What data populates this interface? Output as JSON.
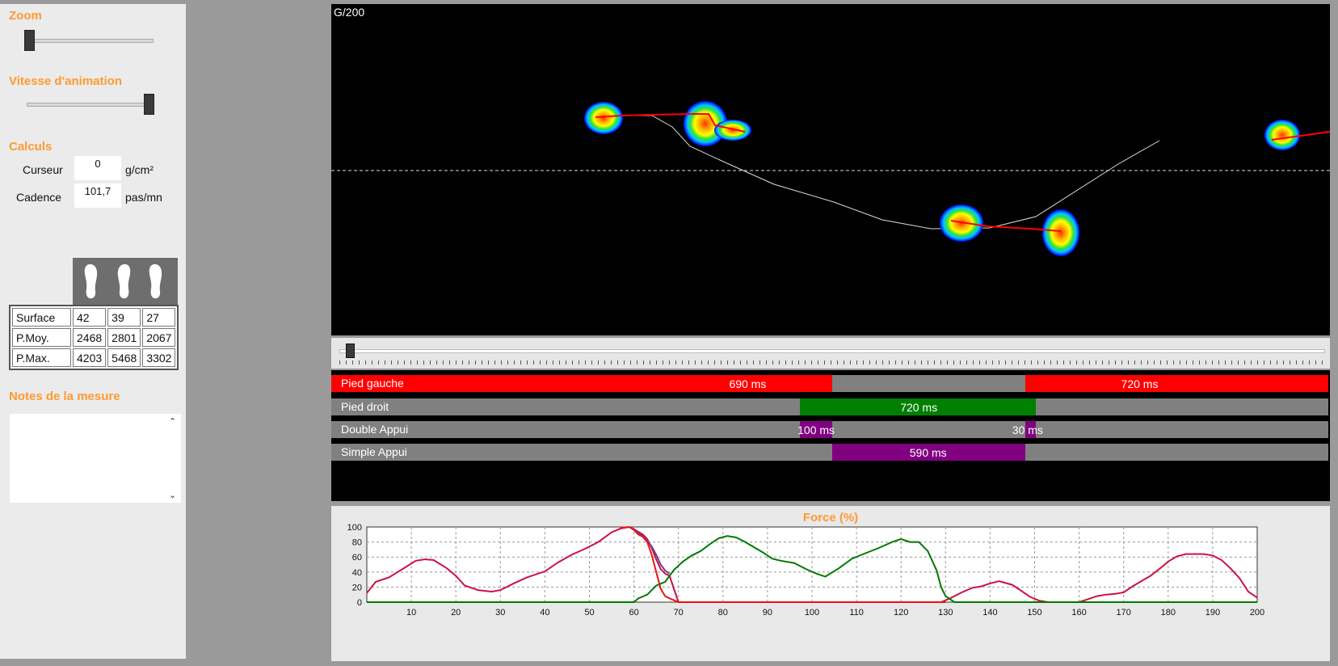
{
  "left": {
    "zoom_label": "Zoom",
    "zoom_value": 0.0,
    "speed_label": "Vitesse d'animation",
    "speed_value": 1.0,
    "calculs_label": "Calculs",
    "curseur_label": "Curseur",
    "curseur_value": "0",
    "curseur_unit": "g/cm²",
    "cadence_label": "Cadence",
    "cadence_value": "101,7",
    "cadence_unit": "pas/mn",
    "stats": [
      {
        "label": "Surface",
        "v1": "42",
        "v2": "39",
        "v3": "27"
      },
      {
        "label": "P.Moy.",
        "v1": "2468",
        "v2": "2801",
        "v3": "2067"
      },
      {
        "label": "P.Max.",
        "v1": "4203",
        "v2": "5468",
        "v3": "3302"
      }
    ],
    "notes_label": "Notes de la mesure"
  },
  "heatmap": {
    "label": "G/200"
  },
  "phases": [
    {
      "name": "Pied gauche",
      "segments": [
        {
          "start": 0,
          "end": 64.5,
          "color": "#ff0000",
          "label": "690 ms",
          "label_at": 37
        },
        {
          "start": 126.5,
          "end": 200,
          "color": "#ff0000",
          "label": "720 ms",
          "label_at": 163
        }
      ]
    },
    {
      "name": "Pied droit",
      "segments": [
        {
          "start": 54,
          "end": 130,
          "color": "#008000",
          "label": "720 ms",
          "label_at": 92
        }
      ]
    },
    {
      "name": "Double Appui",
      "segments": [
        {
          "start": 54,
          "end": 64.5,
          "color": "#800080",
          "label": "100 ms",
          "label_at": 59
        },
        {
          "start": 126.5,
          "end": 130,
          "color": "#800080",
          "label": "30 ms",
          "label_at": 128
        }
      ]
    },
    {
      "name": "Simple Appui",
      "segments": [
        {
          "start": 64.5,
          "end": 126.5,
          "color": "#800080",
          "label": "590 ms",
          "label_at": 95
        }
      ]
    }
  ],
  "force_title": "Force (%)",
  "chart_data": {
    "type": "line",
    "title": "Force (%)",
    "xlim": [
      0,
      200
    ],
    "ylim": [
      0,
      100
    ],
    "x_ticks": [
      10,
      20,
      30,
      40,
      50,
      60,
      70,
      80,
      90,
      100,
      110,
      120,
      130,
      140,
      150,
      160,
      170,
      180,
      190,
      200
    ],
    "y_ticks": [
      0,
      20,
      40,
      60,
      80,
      100
    ],
    "grid": true,
    "series": [
      {
        "color": "#cc1144",
        "points": [
          [
            0,
            12
          ],
          [
            2,
            27
          ],
          [
            5,
            33
          ],
          [
            8,
            44
          ],
          [
            11,
            55
          ],
          [
            13,
            57
          ],
          [
            15,
            56
          ],
          [
            18,
            45
          ],
          [
            20,
            35
          ],
          [
            22,
            22
          ],
          [
            25,
            16
          ],
          [
            28,
            14
          ],
          [
            30,
            16
          ],
          [
            33,
            25
          ],
          [
            36,
            33
          ],
          [
            40,
            41
          ],
          [
            43,
            53
          ],
          [
            46,
            63
          ],
          [
            49,
            71
          ],
          [
            52,
            80
          ],
          [
            55,
            93
          ],
          [
            57,
            98
          ],
          [
            59,
            100
          ],
          [
            60,
            97
          ],
          [
            62,
            90
          ],
          [
            63,
            84
          ],
          [
            64,
            72
          ],
          [
            65,
            57
          ],
          [
            66,
            44
          ],
          [
            67,
            38
          ],
          [
            68,
            35
          ],
          [
            70,
            0
          ],
          [
            129,
            0
          ],
          [
            131,
            5
          ],
          [
            134,
            14
          ],
          [
            136,
            19
          ],
          [
            138,
            21
          ],
          [
            140,
            25
          ],
          [
            142,
            28
          ],
          [
            145,
            23
          ],
          [
            147,
            15
          ],
          [
            149,
            7
          ],
          [
            151,
            2
          ],
          [
            153,
            0
          ],
          [
            160,
            0
          ],
          [
            162,
            4
          ],
          [
            164,
            8
          ],
          [
            166,
            10
          ],
          [
            168,
            11
          ],
          [
            170,
            13
          ],
          [
            172,
            21
          ],
          [
            174,
            28
          ],
          [
            176,
            35
          ],
          [
            178,
            44
          ],
          [
            180,
            54
          ],
          [
            182,
            61
          ],
          [
            184,
            64
          ],
          [
            186,
            64
          ],
          [
            188,
            64
          ],
          [
            190,
            62
          ],
          [
            192,
            56
          ],
          [
            194,
            45
          ],
          [
            196,
            32
          ],
          [
            198,
            14
          ],
          [
            200,
            6
          ]
        ]
      },
      {
        "color": "#6a3d9a",
        "points": [
          [
            60,
            97
          ],
          [
            61,
            92
          ],
          [
            62,
            88
          ],
          [
            63,
            82
          ],
          [
            64,
            74
          ],
          [
            65,
            63
          ],
          [
            66,
            50
          ],
          [
            67,
            42
          ],
          [
            68,
            38
          ]
        ]
      },
      {
        "color": "#ee1111",
        "points": [
          [
            57,
            99
          ],
          [
            59,
            100
          ],
          [
            60,
            96
          ],
          [
            61,
            90
          ],
          [
            62,
            87
          ],
          [
            63,
            80
          ],
          [
            64,
            63
          ],
          [
            65,
            40
          ],
          [
            66,
            18
          ],
          [
            67,
            8
          ],
          [
            68,
            5
          ],
          [
            70,
            0
          ],
          [
            130,
            0
          ]
        ]
      },
      {
        "color": "#007a00",
        "points": [
          [
            0,
            0
          ],
          [
            60,
            0
          ],
          [
            61,
            5
          ],
          [
            63,
            10
          ],
          [
            65,
            22
          ],
          [
            67,
            27
          ],
          [
            69,
            43
          ],
          [
            71,
            54
          ],
          [
            73,
            62
          ],
          [
            75,
            68
          ],
          [
            77,
            77
          ],
          [
            79,
            85
          ],
          [
            81,
            88
          ],
          [
            83,
            86
          ],
          [
            85,
            80
          ],
          [
            87,
            73
          ],
          [
            89,
            66
          ],
          [
            91,
            58
          ],
          [
            93,
            55
          ],
          [
            96,
            52
          ],
          [
            99,
            43
          ],
          [
            101,
            38
          ],
          [
            103,
            34
          ],
          [
            106,
            45
          ],
          [
            109,
            58
          ],
          [
            112,
            65
          ],
          [
            115,
            72
          ],
          [
            118,
            80
          ],
          [
            120,
            84
          ],
          [
            122,
            80
          ],
          [
            124,
            80
          ],
          [
            126,
            68
          ],
          [
            128,
            42
          ],
          [
            129,
            20
          ],
          [
            130,
            8
          ],
          [
            132,
            0
          ],
          [
            200,
            0
          ]
        ]
      }
    ]
  }
}
